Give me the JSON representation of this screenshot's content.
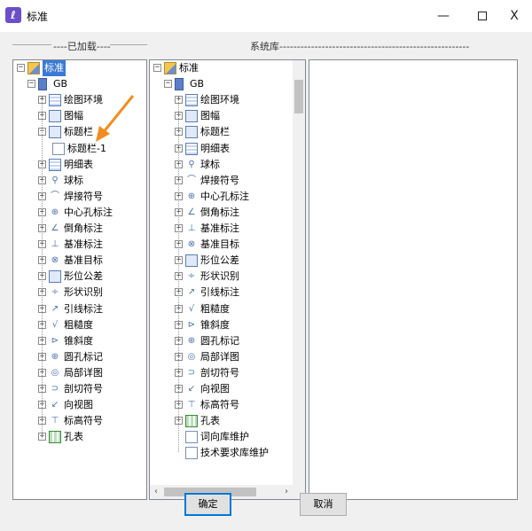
{
  "window": {
    "title": "标准",
    "icon": "app-logo-icon",
    "minimize_glyph": "—",
    "close_glyph": "X"
  },
  "groups": {
    "loaded_label": "----已加载----",
    "library_label": "系统库------------------------------------------------------"
  },
  "left_tree": [
    {
      "label": "标准",
      "level": 0,
      "icon": "book-icon",
      "selected": true
    },
    {
      "label": "GB",
      "level": 1,
      "icon": "gb-icon"
    },
    {
      "label": "绘图环境",
      "level": 2,
      "icon": "grid-icon"
    },
    {
      "label": "图幅",
      "level": 2,
      "icon": "frame-icon"
    },
    {
      "label": "标题栏",
      "level": 2,
      "icon": "titlebar-icon"
    },
    {
      "label": "标题栏-1",
      "level": 3,
      "icon": "doc-icon"
    },
    {
      "label": "明细表",
      "level": 2,
      "icon": "table-icon"
    },
    {
      "label": "球标",
      "level": 2,
      "icon": "balloon-icon"
    },
    {
      "label": "焊接符号",
      "level": 2,
      "icon": "weld-icon"
    },
    {
      "label": "中心孔标注",
      "level": 2,
      "icon": "center-hole-icon"
    },
    {
      "label": "倒角标注",
      "level": 2,
      "icon": "chamfer-icon"
    },
    {
      "label": "基准标注",
      "level": 2,
      "icon": "datum-icon"
    },
    {
      "label": "基准目标",
      "level": 2,
      "icon": "datum-target-icon"
    },
    {
      "label": "形位公差",
      "level": 2,
      "icon": "tolerance-icon"
    },
    {
      "label": "形状识别",
      "level": 2,
      "icon": "shape-icon"
    },
    {
      "label": "引线标注",
      "level": 2,
      "icon": "leader-icon"
    },
    {
      "label": "粗糙度",
      "level": 2,
      "icon": "roughness-icon"
    },
    {
      "label": "锥斜度",
      "level": 2,
      "icon": "taper-icon"
    },
    {
      "label": "圆孔标记",
      "level": 2,
      "icon": "hole-mark-icon"
    },
    {
      "label": "局部详图",
      "level": 2,
      "icon": "detail-icon"
    },
    {
      "label": "剖切符号",
      "level": 2,
      "icon": "section-icon"
    },
    {
      "label": "向视图",
      "level": 2,
      "icon": "view-icon"
    },
    {
      "label": "标高符号",
      "level": 2,
      "icon": "elevation-icon"
    },
    {
      "label": "孔表",
      "level": 2,
      "icon": "hole-table-icon"
    }
  ],
  "mid_tree": [
    {
      "label": "标准",
      "level": 0,
      "icon": "book-icon"
    },
    {
      "label": "GB",
      "level": 1,
      "icon": "gb-icon"
    },
    {
      "label": "绘图环境",
      "level": 2,
      "icon": "grid-icon"
    },
    {
      "label": "图幅",
      "level": 2,
      "icon": "frame-icon"
    },
    {
      "label": "标题栏",
      "level": 2,
      "icon": "titlebar-icon"
    },
    {
      "label": "明细表",
      "level": 2,
      "icon": "table-icon"
    },
    {
      "label": "球标",
      "level": 2,
      "icon": "balloon-icon"
    },
    {
      "label": "焊接符号",
      "level": 2,
      "icon": "weld-icon"
    },
    {
      "label": "中心孔标注",
      "level": 2,
      "icon": "center-hole-icon"
    },
    {
      "label": "倒角标注",
      "level": 2,
      "icon": "chamfer-icon"
    },
    {
      "label": "基准标注",
      "level": 2,
      "icon": "datum-icon"
    },
    {
      "label": "基准目标",
      "level": 2,
      "icon": "datum-target-icon"
    },
    {
      "label": "形位公差",
      "level": 2,
      "icon": "tolerance-icon"
    },
    {
      "label": "形状识别",
      "level": 2,
      "icon": "shape-icon"
    },
    {
      "label": "引线标注",
      "level": 2,
      "icon": "leader-icon"
    },
    {
      "label": "粗糙度",
      "level": 2,
      "icon": "roughness-icon"
    },
    {
      "label": "锥斜度",
      "level": 2,
      "icon": "taper-icon"
    },
    {
      "label": "圆孔标记",
      "level": 2,
      "icon": "hole-mark-icon"
    },
    {
      "label": "局部详图",
      "level": 2,
      "icon": "detail-icon"
    },
    {
      "label": "剖切符号",
      "level": 2,
      "icon": "section-icon"
    },
    {
      "label": "向视图",
      "level": 2,
      "icon": "view-icon"
    },
    {
      "label": "标高符号",
      "level": 2,
      "icon": "elevation-icon"
    },
    {
      "label": "孔表",
      "level": 2,
      "icon": "hole-table-icon"
    },
    {
      "label": "词向库维护",
      "level": 2,
      "icon": "doc-icon",
      "leaf": true
    },
    {
      "label": "技术要求库维护",
      "level": 2,
      "icon": "doc-icon",
      "leaf": true
    }
  ],
  "scroll": {
    "left_arrow": "‹",
    "right_arrow": "›"
  },
  "buttons": {
    "ok": "确定",
    "cancel": "取消"
  },
  "colors": {
    "selection": "#3a7ad6",
    "accent_arrow": "#f28c1e",
    "default_button_border": "#0078d7"
  }
}
